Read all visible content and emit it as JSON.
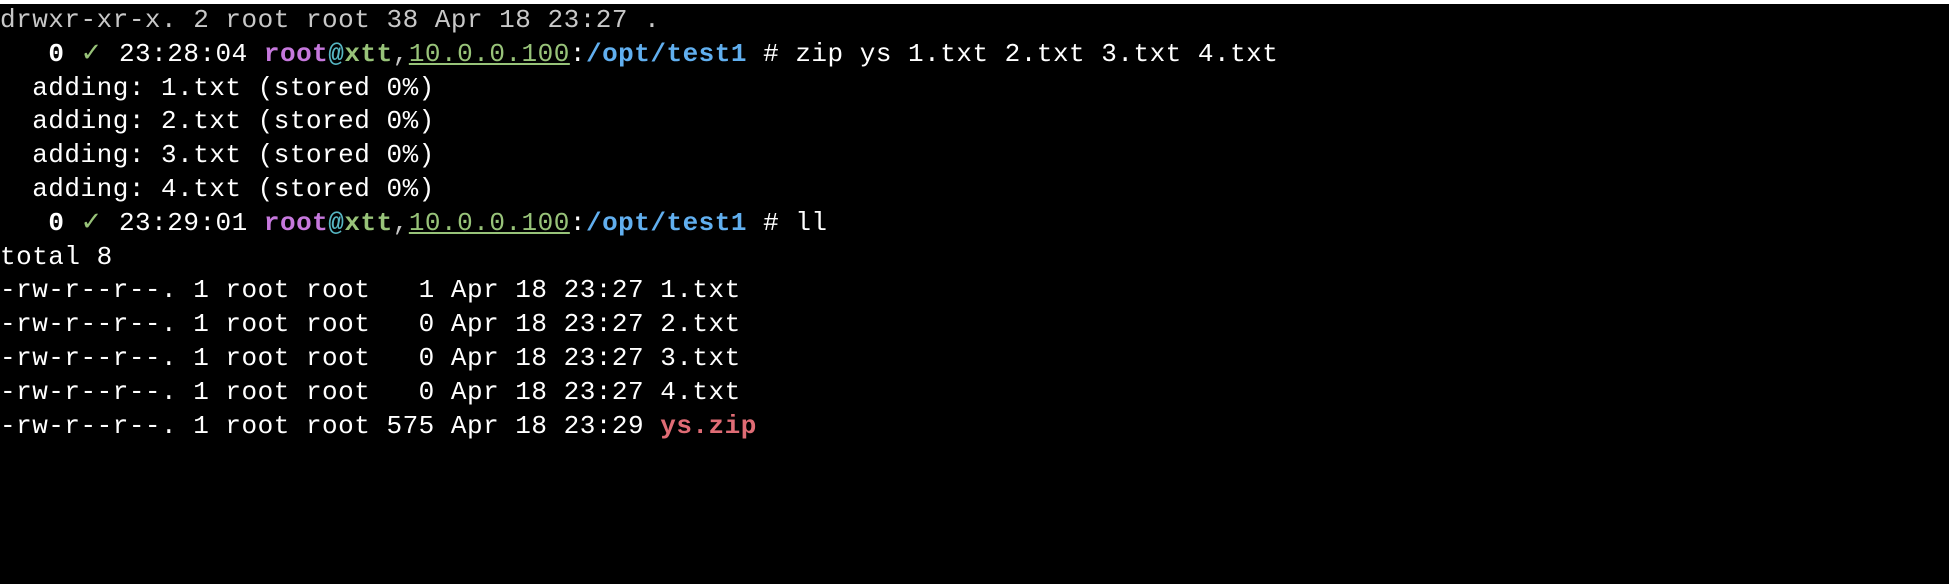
{
  "top_partial": "drwxr-xr-x. 2 root root 38 Apr 18 23:27 .",
  "prompts": [
    {
      "status": "0",
      "check": "✓",
      "time": "23:28:04",
      "user": "root",
      "at": "@",
      "host": "xtt",
      "comma": ",",
      "ip": "10.0.0.100",
      "colon": ":",
      "path": "/opt/test1",
      "hash": " # ",
      "cmd": "zip ys 1.txt 2.txt 3.txt 4.txt"
    },
    {
      "status": "0",
      "check": "✓",
      "time": "23:29:01",
      "user": "root",
      "at": "@",
      "host": "xtt",
      "comma": ",",
      "ip": "10.0.0.100",
      "colon": ":",
      "path": "/opt/test1",
      "hash": " # ",
      "cmd": "ll"
    }
  ],
  "zip_output": [
    "  adding: 1.txt (stored 0%)",
    "  adding: 2.txt (stored 0%)",
    "  adding: 3.txt (stored 0%)",
    "  adding: 4.txt (stored 0%)"
  ],
  "ll_header": "total 8",
  "ll_rows": [
    {
      "pre": "-rw-r--r--. 1 root root   1 Apr 18 23:27 ",
      "name": "1.txt",
      "color": "white"
    },
    {
      "pre": "-rw-r--r--. 1 root root   0 Apr 18 23:27 ",
      "name": "2.txt",
      "color": "white"
    },
    {
      "pre": "-rw-r--r--. 1 root root   0 Apr 18 23:27 ",
      "name": "3.txt",
      "color": "white"
    },
    {
      "pre": "-rw-r--r--. 1 root root   0 Apr 18 23:27 ",
      "name": "4.txt",
      "color": "white"
    },
    {
      "pre": "-rw-r--r--. 1 root root 575 Apr 18 23:29 ",
      "name": "ys.zip",
      "color": "red"
    }
  ]
}
